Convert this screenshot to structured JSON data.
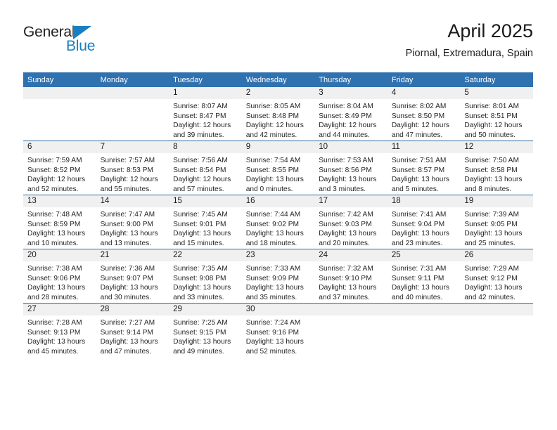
{
  "brand": {
    "name_top": "General",
    "name_bottom": "Blue",
    "triangle_icon": "blue-triangle-icon",
    "accent_color": "#1a7fc1"
  },
  "header": {
    "title": "April 2025",
    "subtitle": "Piornal, Extremadura, Spain"
  },
  "theme": {
    "header_blue": "#3071b0",
    "row_rule_blue": "#2e6da4",
    "daynum_band_grey": "#f0f0f0"
  },
  "weekday_headers": [
    "Sunday",
    "Monday",
    "Tuesday",
    "Wednesday",
    "Thursday",
    "Friday",
    "Saturday"
  ],
  "weeks": [
    [
      {
        "day": "",
        "lines": []
      },
      {
        "day": "",
        "lines": []
      },
      {
        "day": "1",
        "lines": [
          "Sunrise: 8:07 AM",
          "Sunset: 8:47 PM",
          "Daylight: 12 hours",
          "and 39 minutes."
        ]
      },
      {
        "day": "2",
        "lines": [
          "Sunrise: 8:05 AM",
          "Sunset: 8:48 PM",
          "Daylight: 12 hours",
          "and 42 minutes."
        ]
      },
      {
        "day": "3",
        "lines": [
          "Sunrise: 8:04 AM",
          "Sunset: 8:49 PM",
          "Daylight: 12 hours",
          "and 44 minutes."
        ]
      },
      {
        "day": "4",
        "lines": [
          "Sunrise: 8:02 AM",
          "Sunset: 8:50 PM",
          "Daylight: 12 hours",
          "and 47 minutes."
        ]
      },
      {
        "day": "5",
        "lines": [
          "Sunrise: 8:01 AM",
          "Sunset: 8:51 PM",
          "Daylight: 12 hours",
          "and 50 minutes."
        ]
      }
    ],
    [
      {
        "day": "6",
        "lines": [
          "Sunrise: 7:59 AM",
          "Sunset: 8:52 PM",
          "Daylight: 12 hours",
          "and 52 minutes."
        ]
      },
      {
        "day": "7",
        "lines": [
          "Sunrise: 7:57 AM",
          "Sunset: 8:53 PM",
          "Daylight: 12 hours",
          "and 55 minutes."
        ]
      },
      {
        "day": "8",
        "lines": [
          "Sunrise: 7:56 AM",
          "Sunset: 8:54 PM",
          "Daylight: 12 hours",
          "and 57 minutes."
        ]
      },
      {
        "day": "9",
        "lines": [
          "Sunrise: 7:54 AM",
          "Sunset: 8:55 PM",
          "Daylight: 13 hours",
          "and 0 minutes."
        ]
      },
      {
        "day": "10",
        "lines": [
          "Sunrise: 7:53 AM",
          "Sunset: 8:56 PM",
          "Daylight: 13 hours",
          "and 3 minutes."
        ]
      },
      {
        "day": "11",
        "lines": [
          "Sunrise: 7:51 AM",
          "Sunset: 8:57 PM",
          "Daylight: 13 hours",
          "and 5 minutes."
        ]
      },
      {
        "day": "12",
        "lines": [
          "Sunrise: 7:50 AM",
          "Sunset: 8:58 PM",
          "Daylight: 13 hours",
          "and 8 minutes."
        ]
      }
    ],
    [
      {
        "day": "13",
        "lines": [
          "Sunrise: 7:48 AM",
          "Sunset: 8:59 PM",
          "Daylight: 13 hours",
          "and 10 minutes."
        ]
      },
      {
        "day": "14",
        "lines": [
          "Sunrise: 7:47 AM",
          "Sunset: 9:00 PM",
          "Daylight: 13 hours",
          "and 13 minutes."
        ]
      },
      {
        "day": "15",
        "lines": [
          "Sunrise: 7:45 AM",
          "Sunset: 9:01 PM",
          "Daylight: 13 hours",
          "and 15 minutes."
        ]
      },
      {
        "day": "16",
        "lines": [
          "Sunrise: 7:44 AM",
          "Sunset: 9:02 PM",
          "Daylight: 13 hours",
          "and 18 minutes."
        ]
      },
      {
        "day": "17",
        "lines": [
          "Sunrise: 7:42 AM",
          "Sunset: 9:03 PM",
          "Daylight: 13 hours",
          "and 20 minutes."
        ]
      },
      {
        "day": "18",
        "lines": [
          "Sunrise: 7:41 AM",
          "Sunset: 9:04 PM",
          "Daylight: 13 hours",
          "and 23 minutes."
        ]
      },
      {
        "day": "19",
        "lines": [
          "Sunrise: 7:39 AM",
          "Sunset: 9:05 PM",
          "Daylight: 13 hours",
          "and 25 minutes."
        ]
      }
    ],
    [
      {
        "day": "20",
        "lines": [
          "Sunrise: 7:38 AM",
          "Sunset: 9:06 PM",
          "Daylight: 13 hours",
          "and 28 minutes."
        ]
      },
      {
        "day": "21",
        "lines": [
          "Sunrise: 7:36 AM",
          "Sunset: 9:07 PM",
          "Daylight: 13 hours",
          "and 30 minutes."
        ]
      },
      {
        "day": "22",
        "lines": [
          "Sunrise: 7:35 AM",
          "Sunset: 9:08 PM",
          "Daylight: 13 hours",
          "and 33 minutes."
        ]
      },
      {
        "day": "23",
        "lines": [
          "Sunrise: 7:33 AM",
          "Sunset: 9:09 PM",
          "Daylight: 13 hours",
          "and 35 minutes."
        ]
      },
      {
        "day": "24",
        "lines": [
          "Sunrise: 7:32 AM",
          "Sunset: 9:10 PM",
          "Daylight: 13 hours",
          "and 37 minutes."
        ]
      },
      {
        "day": "25",
        "lines": [
          "Sunrise: 7:31 AM",
          "Sunset: 9:11 PM",
          "Daylight: 13 hours",
          "and 40 minutes."
        ]
      },
      {
        "day": "26",
        "lines": [
          "Sunrise: 7:29 AM",
          "Sunset: 9:12 PM",
          "Daylight: 13 hours",
          "and 42 minutes."
        ]
      }
    ],
    [
      {
        "day": "27",
        "lines": [
          "Sunrise: 7:28 AM",
          "Sunset: 9:13 PM",
          "Daylight: 13 hours",
          "and 45 minutes."
        ]
      },
      {
        "day": "28",
        "lines": [
          "Sunrise: 7:27 AM",
          "Sunset: 9:14 PM",
          "Daylight: 13 hours",
          "and 47 minutes."
        ]
      },
      {
        "day": "29",
        "lines": [
          "Sunrise: 7:25 AM",
          "Sunset: 9:15 PM",
          "Daylight: 13 hours",
          "and 49 minutes."
        ]
      },
      {
        "day": "30",
        "lines": [
          "Sunrise: 7:24 AM",
          "Sunset: 9:16 PM",
          "Daylight: 13 hours",
          "and 52 minutes."
        ]
      },
      {
        "day": "",
        "lines": []
      },
      {
        "day": "",
        "lines": []
      },
      {
        "day": "",
        "lines": []
      }
    ]
  ]
}
